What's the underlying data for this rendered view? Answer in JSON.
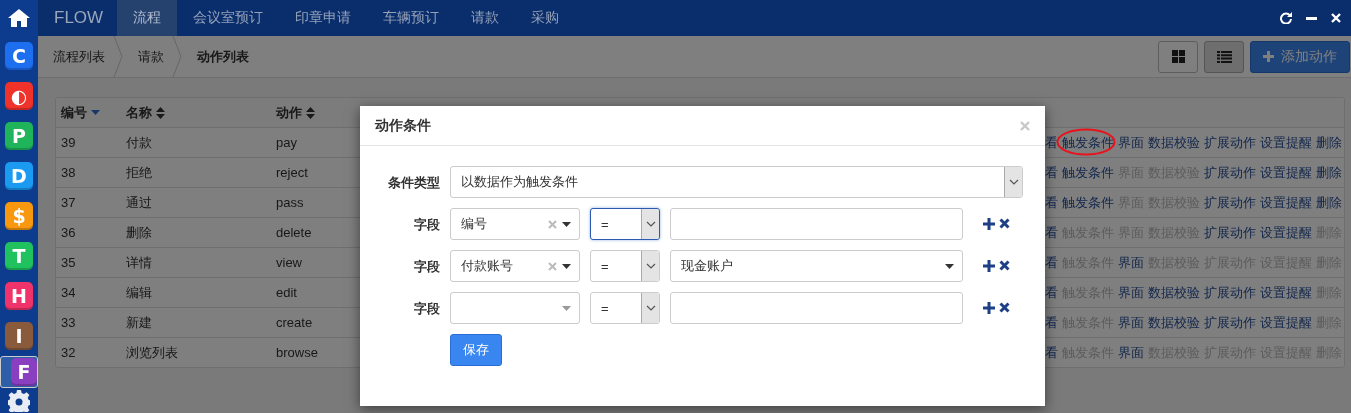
{
  "sidebar": {
    "apps": [
      {
        "letter": "C",
        "color": "#1e6ff0",
        "selected": false
      },
      {
        "letter": "◐",
        "color": "#f0332a",
        "selected": false
      },
      {
        "letter": "P",
        "color": "#1fb45a",
        "selected": false
      },
      {
        "letter": "D",
        "color": "#1a9af0",
        "selected": false
      },
      {
        "letter": "$",
        "color": "#f7980f",
        "selected": false
      },
      {
        "letter": "T",
        "color": "#1fc25e",
        "selected": false
      },
      {
        "letter": "H",
        "color": "#f0336a",
        "selected": false
      },
      {
        "letter": "I",
        "color": "#8a5a3c",
        "selected": false
      },
      {
        "letter": "F",
        "color": "#8a3fc0",
        "selected": true
      }
    ]
  },
  "navbar": {
    "brand": "FLOW",
    "tabs": [
      {
        "label": "流程",
        "selected": true
      },
      {
        "label": "会议室预订",
        "selected": false
      },
      {
        "label": "印章申请",
        "selected": false
      },
      {
        "label": "车辆预订",
        "selected": false
      },
      {
        "label": "请款",
        "selected": false
      },
      {
        "label": "采购",
        "selected": false
      }
    ]
  },
  "breadcrumb": [
    {
      "label": "流程列表",
      "current": false
    },
    {
      "label": "请款",
      "current": false
    },
    {
      "label": "动作列表",
      "current": true
    }
  ],
  "toolbar": {
    "views": [
      {
        "kind": "grid",
        "selected": false
      },
      {
        "kind": "list",
        "selected": true
      }
    ],
    "add_button": "添加动作"
  },
  "table": {
    "columns": [
      {
        "label": "编号",
        "sorted": true
      },
      {
        "label": "名称",
        "sorted": false
      },
      {
        "label": "动作",
        "sorted": false
      }
    ],
    "rows": [
      {
        "id": "39",
        "name": "付款",
        "action": "pay",
        "ops": [
          {
            "label": "看",
            "enabled": true,
            "circled": false
          },
          {
            "label": "触发条件",
            "enabled": true,
            "circled": true
          },
          {
            "label": "界面",
            "enabled": true,
            "circled": false
          },
          {
            "label": "数据校验",
            "enabled": true,
            "circled": false
          },
          {
            "label": "扩展动作",
            "enabled": true,
            "circled": false
          },
          {
            "label": "设置提醒",
            "enabled": true,
            "circled": false
          },
          {
            "label": "删除",
            "enabled": true,
            "circled": false
          }
        ]
      },
      {
        "id": "38",
        "name": "拒绝",
        "action": "reject",
        "ops": [
          {
            "label": "看",
            "enabled": true,
            "circled": false
          },
          {
            "label": "触发条件",
            "enabled": true,
            "circled": false
          },
          {
            "label": "界面",
            "enabled": false,
            "circled": false
          },
          {
            "label": "数据校验",
            "enabled": false,
            "circled": false
          },
          {
            "label": "扩展动作",
            "enabled": true,
            "circled": false
          },
          {
            "label": "设置提醒",
            "enabled": true,
            "circled": false
          },
          {
            "label": "删除",
            "enabled": true,
            "circled": false
          }
        ]
      },
      {
        "id": "37",
        "name": "通过",
        "action": "pass",
        "ops": [
          {
            "label": "看",
            "enabled": true,
            "circled": false
          },
          {
            "label": "触发条件",
            "enabled": true,
            "circled": false
          },
          {
            "label": "界面",
            "enabled": false,
            "circled": false
          },
          {
            "label": "数据校验",
            "enabled": false,
            "circled": false
          },
          {
            "label": "扩展动作",
            "enabled": true,
            "circled": false
          },
          {
            "label": "设置提醒",
            "enabled": true,
            "circled": false
          },
          {
            "label": "删除",
            "enabled": true,
            "circled": false
          }
        ]
      },
      {
        "id": "36",
        "name": "删除",
        "action": "delete",
        "ops": [
          {
            "label": "看",
            "enabled": true,
            "circled": false
          },
          {
            "label": "触发条件",
            "enabled": false,
            "circled": false
          },
          {
            "label": "界面",
            "enabled": false,
            "circled": false
          },
          {
            "label": "数据校验",
            "enabled": false,
            "circled": false
          },
          {
            "label": "扩展动作",
            "enabled": true,
            "circled": false
          },
          {
            "label": "设置提醒",
            "enabled": true,
            "circled": false
          },
          {
            "label": "删除",
            "enabled": false,
            "circled": false
          }
        ]
      },
      {
        "id": "35",
        "name": "详情",
        "action": "view",
        "ops": [
          {
            "label": "看",
            "enabled": true,
            "circled": false
          },
          {
            "label": "触发条件",
            "enabled": false,
            "circled": false
          },
          {
            "label": "界面",
            "enabled": true,
            "circled": false
          },
          {
            "label": "数据校验",
            "enabled": false,
            "circled": false
          },
          {
            "label": "扩展动作",
            "enabled": false,
            "circled": false
          },
          {
            "label": "设置提醒",
            "enabled": false,
            "circled": false
          },
          {
            "label": "删除",
            "enabled": false,
            "circled": false
          }
        ]
      },
      {
        "id": "34",
        "name": "编辑",
        "action": "edit",
        "ops": [
          {
            "label": "看",
            "enabled": true,
            "circled": false
          },
          {
            "label": "触发条件",
            "enabled": false,
            "circled": false
          },
          {
            "label": "界面",
            "enabled": true,
            "circled": false
          },
          {
            "label": "数据校验",
            "enabled": true,
            "circled": false
          },
          {
            "label": "扩展动作",
            "enabled": true,
            "circled": false
          },
          {
            "label": "设置提醒",
            "enabled": true,
            "circled": false
          },
          {
            "label": "删除",
            "enabled": false,
            "circled": false
          }
        ]
      },
      {
        "id": "33",
        "name": "新建",
        "action": "create",
        "ops": [
          {
            "label": "看",
            "enabled": true,
            "circled": false
          },
          {
            "label": "触发条件",
            "enabled": false,
            "circled": false
          },
          {
            "label": "界面",
            "enabled": true,
            "circled": false
          },
          {
            "label": "数据校验",
            "enabled": true,
            "circled": false
          },
          {
            "label": "扩展动作",
            "enabled": true,
            "circled": false
          },
          {
            "label": "设置提醒",
            "enabled": true,
            "circled": false
          },
          {
            "label": "删除",
            "enabled": false,
            "circled": false
          }
        ]
      },
      {
        "id": "32",
        "name": "浏览列表",
        "action": "browse",
        "ops": [
          {
            "label": "看",
            "enabled": true,
            "circled": false
          },
          {
            "label": "触发条件",
            "enabled": false,
            "circled": false
          },
          {
            "label": "界面",
            "enabled": true,
            "circled": false
          },
          {
            "label": "数据校验",
            "enabled": false,
            "circled": false
          },
          {
            "label": "扩展动作",
            "enabled": false,
            "circled": false
          },
          {
            "label": "设置提醒",
            "enabled": false,
            "circled": false
          },
          {
            "label": "删除",
            "enabled": false,
            "circled": false
          }
        ]
      }
    ]
  },
  "modal": {
    "title": "动作条件",
    "type_label": "条件类型",
    "type_value": "以数据作为触发条件",
    "conditions": [
      {
        "label": "字段",
        "field": "编号",
        "operator": "=",
        "operator_focused": true,
        "kind": "input"
      },
      {
        "label": "字段",
        "field": "付款账号",
        "operator": "=",
        "operator_focused": false,
        "kind": "select",
        "value": "现金账户"
      },
      {
        "label": "字段",
        "operator": "=",
        "operator_focused": false,
        "kind": "input"
      }
    ],
    "save_button": "保存"
  }
}
